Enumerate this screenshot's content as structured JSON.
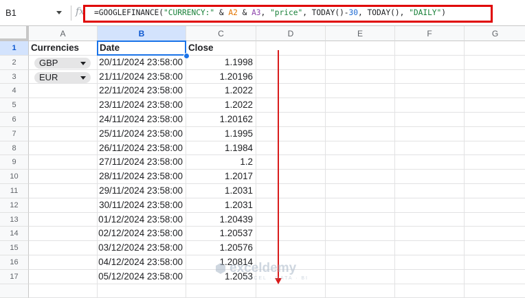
{
  "formula_bar": {
    "name_box": "B1",
    "fx": "fx",
    "formula": {
      "p1": "=GOOGLEFINANCE(",
      "p2": "\"CURRENCY:\"",
      "p3": " & ",
      "p4": "A2",
      "p5": " & ",
      "p6": "A3",
      "p7": ", ",
      "p8": "\"price\"",
      "p9": ", TODAY()-",
      "p10": "30",
      "p11": ", TODAY(), ",
      "p12": "\"DAILY\"",
      "p13": ")"
    }
  },
  "columns": [
    "A",
    "B",
    "C",
    "D",
    "E",
    "F",
    "G"
  ],
  "selected_cell": "B1",
  "header_row": {
    "row": "1",
    "a": "Currencies",
    "b": "Date",
    "c": "Close"
  },
  "chips": [
    {
      "label": "GBP"
    },
    {
      "label": "EUR"
    }
  ],
  "rows": [
    {
      "n": "2",
      "date": "20/11/2024 23:58:00",
      "close": "1.1998"
    },
    {
      "n": "3",
      "date": "21/11/2024 23:58:00",
      "close": "1.20196"
    },
    {
      "n": "4",
      "date": "22/11/2024 23:58:00",
      "close": "1.2022"
    },
    {
      "n": "5",
      "date": "23/11/2024 23:58:00",
      "close": "1.2022"
    },
    {
      "n": "6",
      "date": "24/11/2024 23:58:00",
      "close": "1.20162"
    },
    {
      "n": "7",
      "date": "25/11/2024 23:58:00",
      "close": "1.1995"
    },
    {
      "n": "8",
      "date": "26/11/2024 23:58:00",
      "close": "1.1984"
    },
    {
      "n": "9",
      "date": "27/11/2024 23:58:00",
      "close": "1.2"
    },
    {
      "n": "10",
      "date": "28/11/2024 23:58:00",
      "close": "1.2017"
    },
    {
      "n": "11",
      "date": "29/11/2024 23:58:00",
      "close": "1.2031"
    },
    {
      "n": "12",
      "date": "30/11/2024 23:58:00",
      "close": "1.2031"
    },
    {
      "n": "13",
      "date": "01/12/2024 23:58:00",
      "close": "1.20439"
    },
    {
      "n": "14",
      "date": "02/12/2024 23:58:00",
      "close": "1.20537"
    },
    {
      "n": "15",
      "date": "03/12/2024 23:58:00",
      "close": "1.20576"
    },
    {
      "n": "16",
      "date": "04/12/2024 23:58:00",
      "close": "1.20814"
    },
    {
      "n": "17",
      "date": "05/12/2024 23:58:00",
      "close": "1.2053"
    }
  ],
  "watermark": {
    "name": "exceldemy",
    "tagline": "EXCEL · DATA · BI"
  },
  "colors": {
    "annotation_red": "#e00000",
    "selection_blue": "#1a73e8"
  }
}
